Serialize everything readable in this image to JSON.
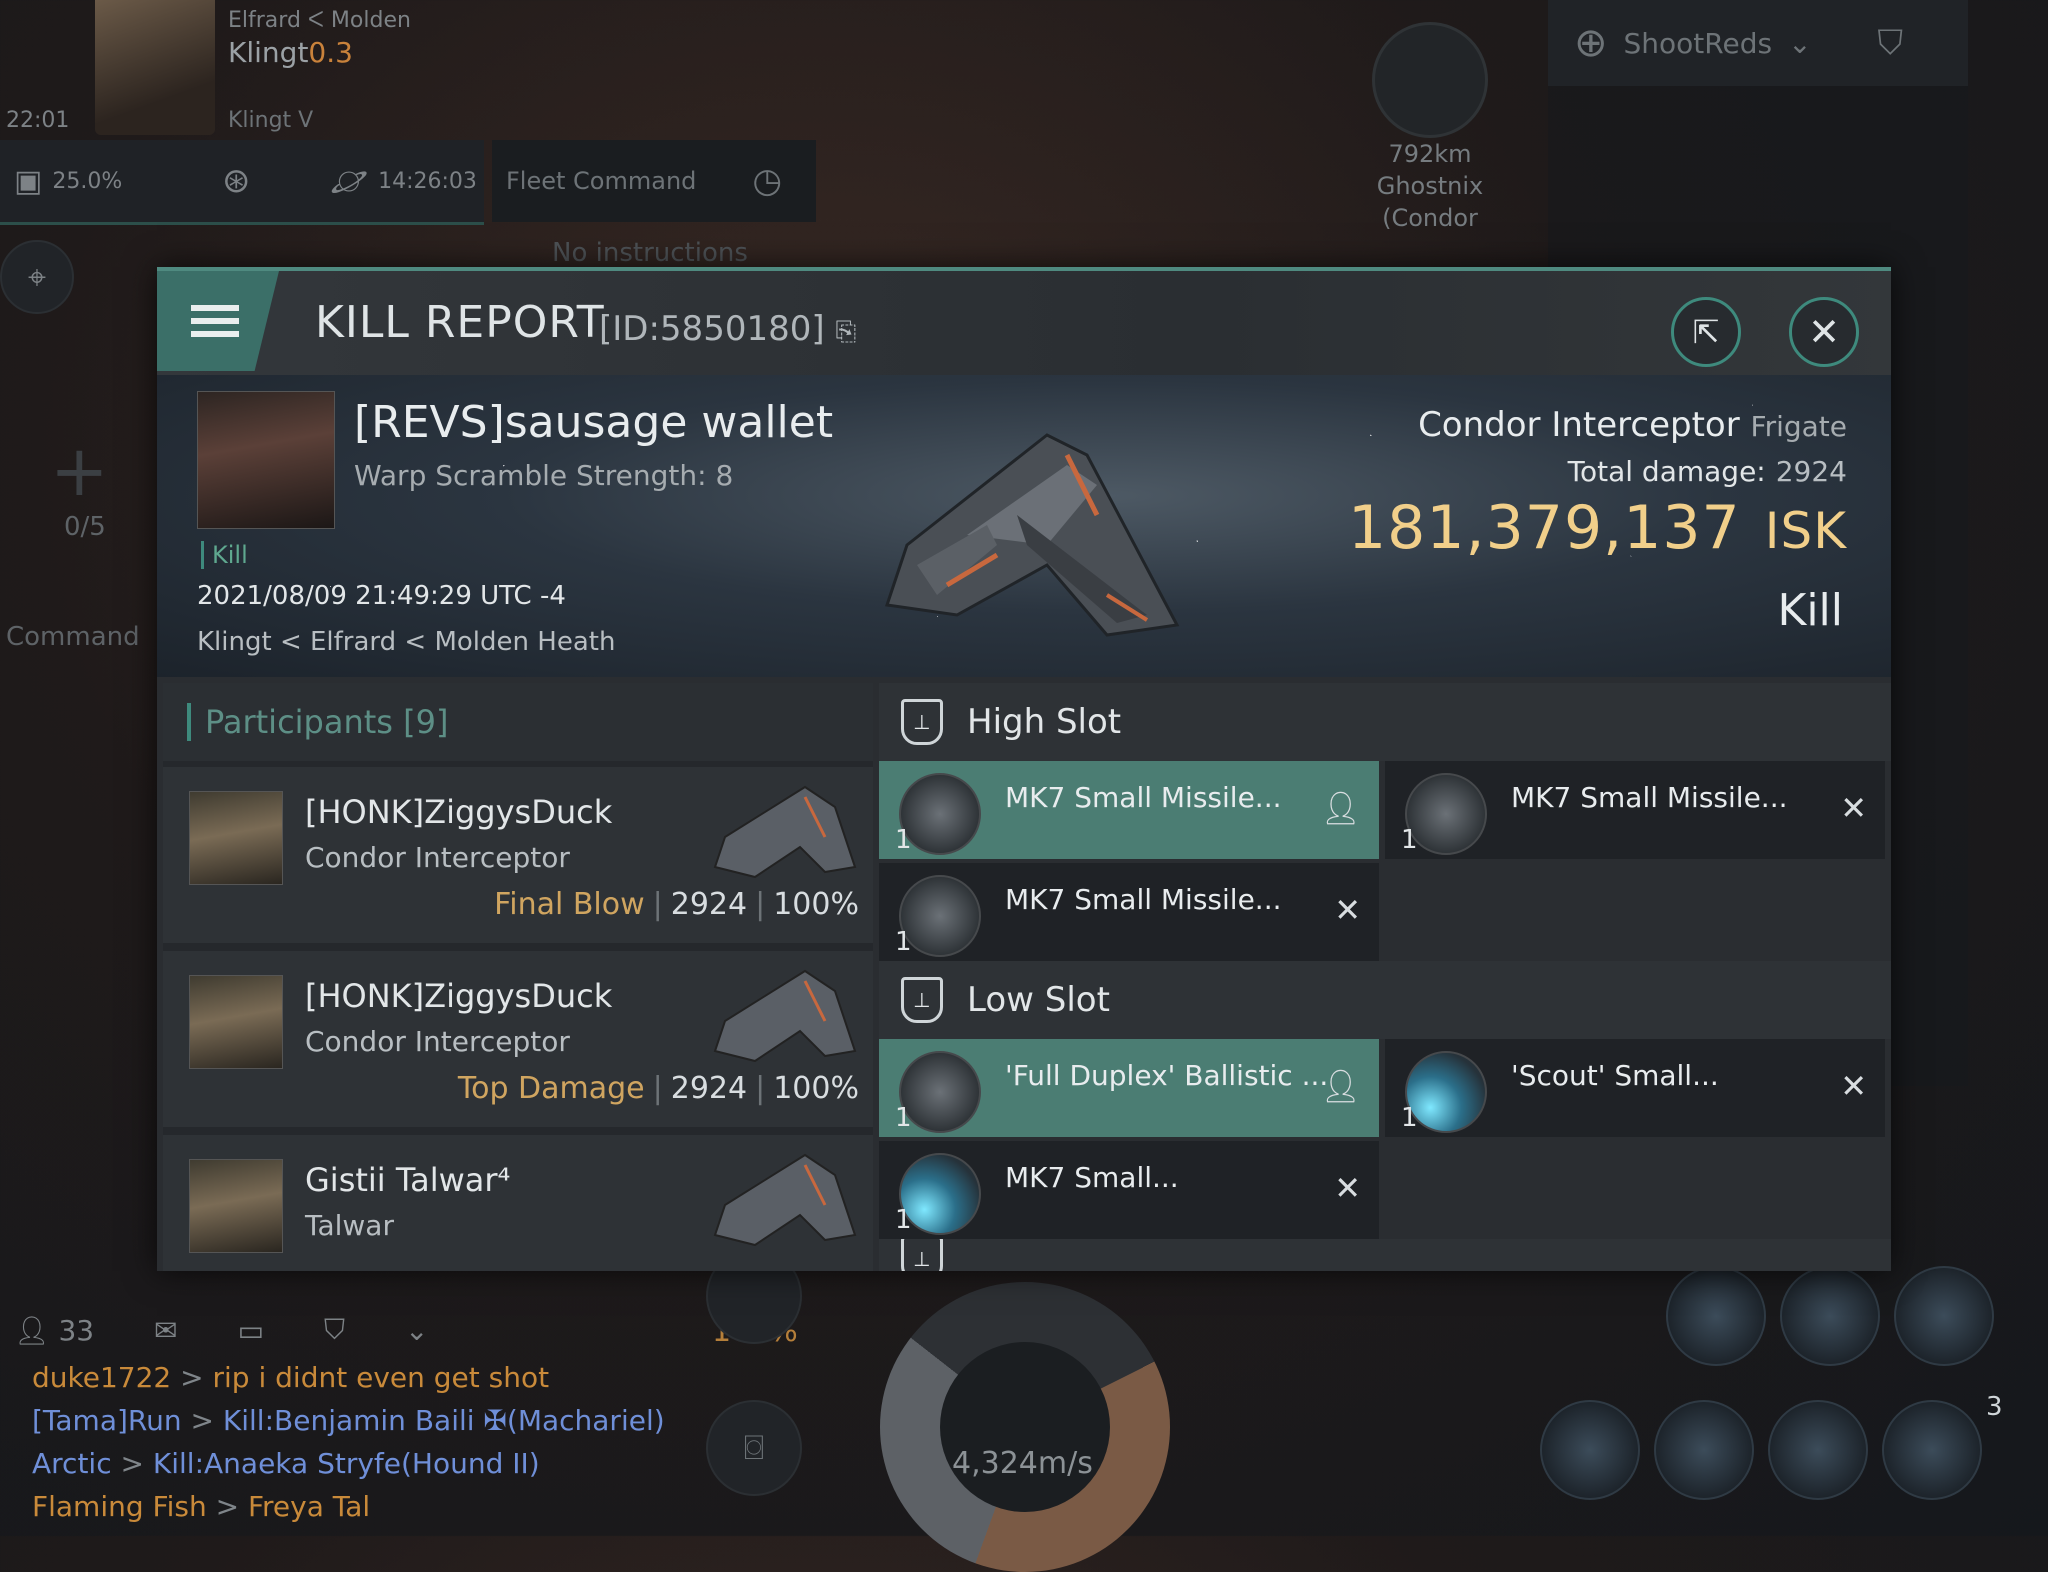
{
  "hud": {
    "pilot_location": "Elfrard  ᐸ Molden",
    "pilot_name": "Klingt",
    "pilot_security": "0.3",
    "pilot_ship": "Klingt V",
    "time": "22:01",
    "cargo_pct": "25.0%",
    "session_timer": "14:26:03",
    "fleet_command_label": "Fleet Command",
    "no_instructions": "No instructions",
    "target_distance": "792km",
    "target_name": "Ghostnix",
    "target_ship": "(Condor",
    "overview_preset": "ShootReds",
    "left_count": "0/5",
    "left_command": "Command",
    "chat_members": "33",
    "hud_pct": "100%",
    "speed": "4,324m/s",
    "module_count": "3"
  },
  "chat": [
    {
      "sender": "duke1722",
      "sep": " > ",
      "text": "rip i didnt even get shot",
      "color": "#c98a3a"
    },
    {
      "sender": "[Tama]Run",
      "sep": " > ",
      "text": "Kill:Benjamin Baili ✠(Machariel)",
      "color": "#6f8fd8"
    },
    {
      "sender": "Arctic",
      "sep": " > ",
      "text": "Kill:Anaeka Stryfe(Hound II)",
      "color": "#6f8fd8"
    },
    {
      "sender": "Flaming Fish",
      "sep": " > ",
      "text": "Freya Tal",
      "color": "#c98a3a"
    }
  ],
  "kill_report": {
    "title": "KILL REPORT",
    "id": "[ID:5850180]",
    "victim_name": "[REVS]sausage wallet",
    "victim_subtitle": "Warp Scramble Strength: 8",
    "kill_tag": "Kill",
    "date": "2021/08/09 21:49:29 UTC -4",
    "location": "Klingt < Elfrard < Molden Heath",
    "ship_name": "Condor Interceptor",
    "ship_class": "Frigate",
    "total_damage_label": "Total damage:",
    "total_damage": "2924",
    "isk_value": "181,379,137",
    "isk_unit": "ISK",
    "result": "Kill",
    "accent_color": "#3e8a7d",
    "isk_color": "#f1cf8a"
  },
  "participants": {
    "label": "Participants",
    "count": "[9]",
    "rows": [
      {
        "name": "[HONK]ZiggysDuck",
        "ship": "Condor Interceptor",
        "role": "Final Blow",
        "damage": "2924",
        "pct": "100%"
      },
      {
        "name": "[HONK]ZiggysDuck",
        "ship": "Condor Interceptor",
        "role": "Top Damage",
        "damage": "2924",
        "pct": "100%"
      },
      {
        "name": "Gistii Talwar⁴",
        "ship": "Talwar",
        "role": "",
        "damage": "",
        "pct": ""
      }
    ]
  },
  "fitting": {
    "high_slot_label": "High Slot",
    "low_slot_label": "Low Slot",
    "high": [
      {
        "name": "MK7 Small Missile...",
        "qty": "1",
        "state": "dropped"
      },
      {
        "name": "MK7 Small Missile...",
        "qty": "1",
        "state": "destroyed"
      },
      {
        "name": "MK7 Small Missile...",
        "qty": "1",
        "state": "destroyed"
      }
    ],
    "low": [
      {
        "name": "'Full Duplex' Ballistic ...",
        "qty": "1",
        "state": "dropped"
      },
      {
        "name": "'Scout' Small...",
        "qty": "1",
        "state": "destroyed"
      },
      {
        "name": "MK7 Small...",
        "qty": "1",
        "state": "destroyed"
      }
    ]
  }
}
